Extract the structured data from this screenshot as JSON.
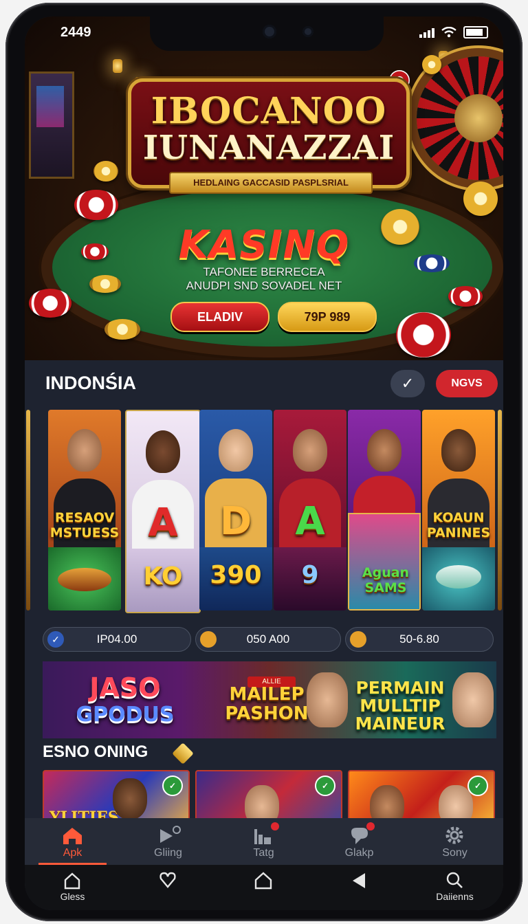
{
  "status_bar": {
    "time": "2449"
  },
  "hero": {
    "logo_line1": "IBOCANOO",
    "logo_line2": "IUNANAZZAI",
    "ribbon": "HEDLAING GACCASID PASPLSRIAL",
    "kasino": "KASINQ",
    "tagline_line1": "TAFONEE BERRECEA",
    "tagline_line2": "ANUDPI SND SOVADEL NET",
    "btn_left": "ELADIV",
    "btn_right": "79P 989"
  },
  "section": {
    "title": "INDONŚIA",
    "check_icon": "✓",
    "news_button": "NGVS"
  },
  "games": [
    {
      "top_text": "RESAOV MSTUESS",
      "bottom_text": ""
    },
    {
      "letter": "A",
      "bottom_text": "KO"
    },
    {
      "letter": "D",
      "bottom_text": "390"
    },
    {
      "letter": "A",
      "bottom_text": "9"
    },
    {
      "top_text": "",
      "bottom_text": "Aguan SAMS"
    },
    {
      "top_text": "KOAUN PANINES",
      "bottom_text": ""
    }
  ],
  "stats": [
    {
      "value": "IP04.00",
      "icon": "check-icon"
    },
    {
      "value": "050 A00",
      "icon": "coin-icon"
    },
    {
      "value": "50-6.80",
      "icon": "coin-icon"
    }
  ],
  "promo": {
    "t1_a": "JASO",
    "t1_b": "GPODUS",
    "tag": "ALLIE",
    "t2": "MAILEP PASHON",
    "t3": "PERMAIN MULLTIP MAINEUR"
  },
  "section2": {
    "title": "ESNO ONING"
  },
  "row2": [
    {
      "text": "YLITIES"
    },
    {
      "text": ""
    },
    {
      "text": ""
    }
  ],
  "tabs": [
    {
      "label": "Apk",
      "icon": "home-icon",
      "active": true
    },
    {
      "label": "Gliing",
      "icon": "play-icon"
    },
    {
      "label": "Tatg",
      "icon": "chart-icon"
    },
    {
      "label": "Glakp",
      "icon": "chat-icon"
    },
    {
      "label": "Sony",
      "icon": "gear-icon"
    }
  ],
  "nav": [
    {
      "label": "Gless",
      "icon": "home-outline-icon"
    },
    {
      "label": "",
      "icon": "heart-icon"
    },
    {
      "label": "",
      "icon": "home-button-icon"
    },
    {
      "label": "",
      "icon": "back-icon"
    },
    {
      "label": "Daiienns",
      "icon": "search-icon"
    }
  ],
  "colors": {
    "accent_red": "#d1262d",
    "tab_active": "#ff5a3a",
    "section_bg": "#1e2330"
  }
}
